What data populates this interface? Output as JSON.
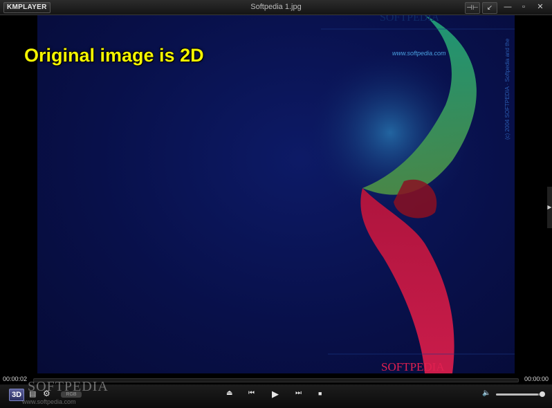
{
  "app": {
    "logo": "KMPLAYER",
    "title": "Softpedia 1.jpg"
  },
  "titlebar_buttons": {
    "pin": "⊣⊢",
    "compact": "↙",
    "minimize": "—",
    "maximize": "▫",
    "close": "✕"
  },
  "video": {
    "overlay_text": "Original image is 2D",
    "image_text_top": "SOFTPEDIA",
    "image_text_url": "www.softpedia.com",
    "image_text_bottom": "SOFTPEDIA",
    "image_text_side": "(c) 2004 SOFTPEDIA · Softpedia and the"
  },
  "playback": {
    "time_elapsed": "00:00:02",
    "time_total": "00:00:00",
    "progress": 0.0
  },
  "controls": {
    "btn_3d": "3D",
    "playlist_icon": "▤",
    "settings_icon": "⚙",
    "rgb_label": "RGB",
    "eject": "⏏",
    "prev": "⏮",
    "play": "▶",
    "next": "⏭",
    "stop": "■",
    "volume_icon": "🔈",
    "volume_level": 0.9
  },
  "watermark": {
    "brand": "SOFTPEDIA",
    "url": "www.softpedia.com"
  },
  "colors": {
    "overlay_text": "#f4f400",
    "frame_bg": "#08104a"
  }
}
